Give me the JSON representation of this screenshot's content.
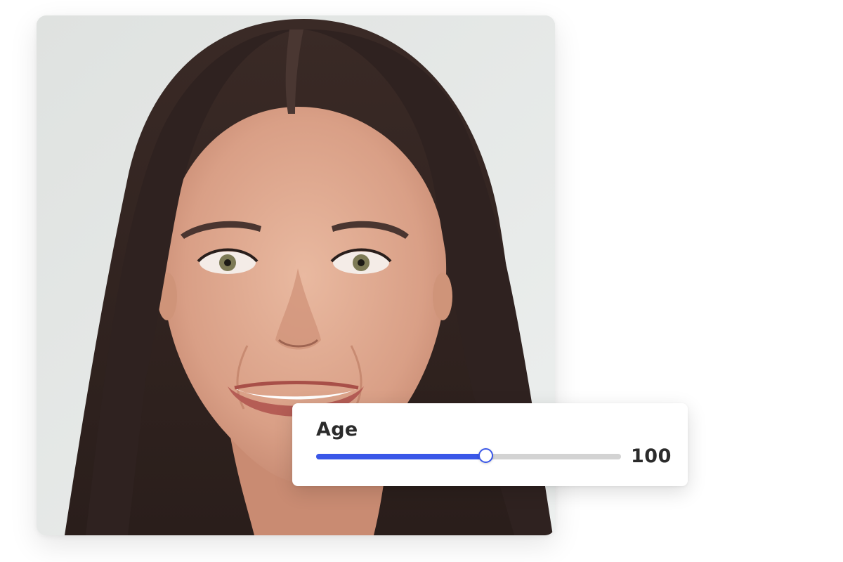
{
  "photo": {
    "subject_icon": "portrait-photo"
  },
  "age_control": {
    "label": "Age",
    "value": "100",
    "slider_fraction": 0.56,
    "accent_color": "#3a57e8",
    "track_color": "#d3d3d3"
  }
}
